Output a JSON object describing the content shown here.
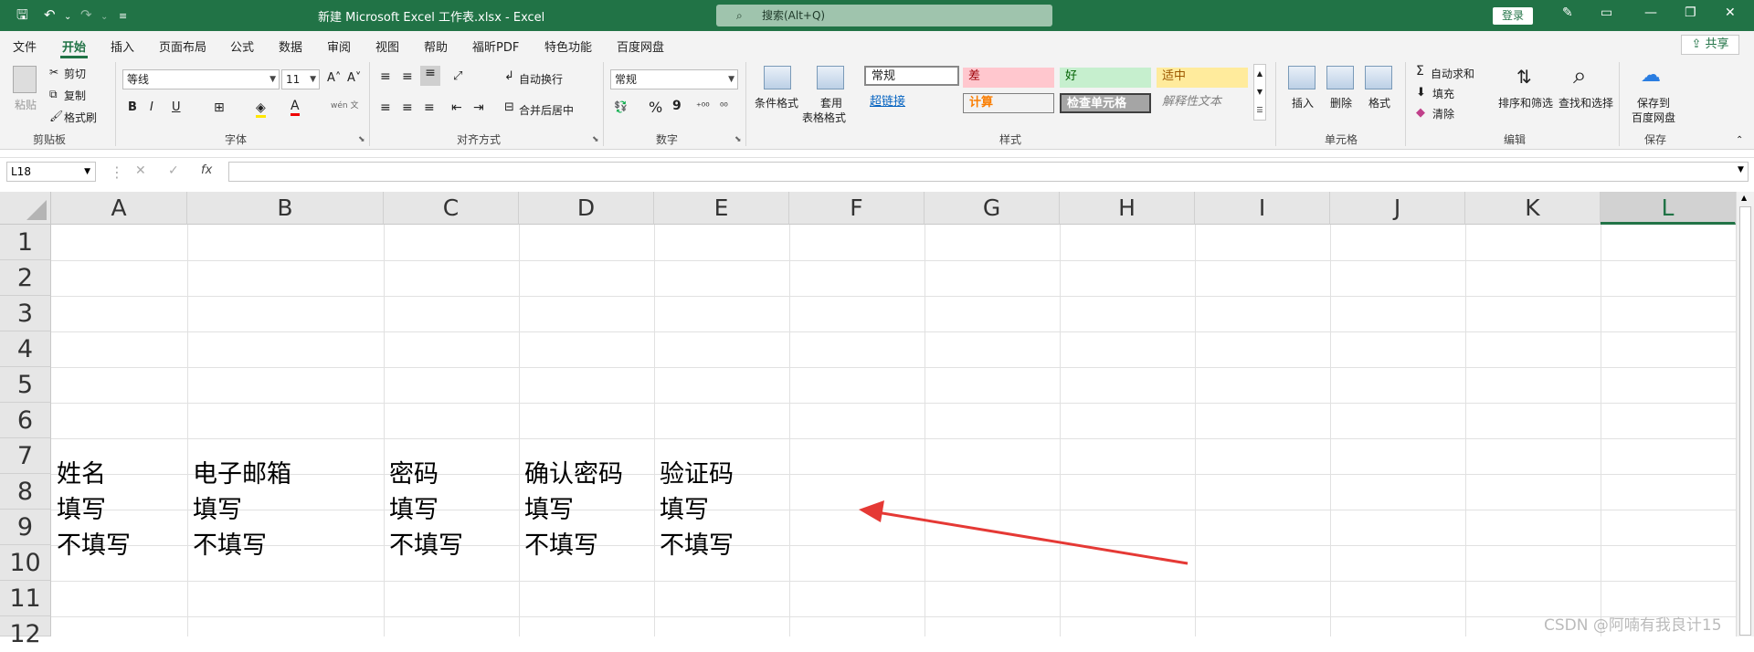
{
  "titlebar": {
    "title": "新建 Microsoft Excel 工作表.xlsx  -  Excel",
    "search_placeholder": "搜索(Alt+Q)",
    "login_label": "登录"
  },
  "menu": {
    "items": [
      "文件",
      "开始",
      "插入",
      "页面布局",
      "公式",
      "数据",
      "审阅",
      "视图",
      "帮助",
      "福昕PDF",
      "特色功能",
      "百度网盘"
    ],
    "share_label": "共享"
  },
  "ribbon": {
    "clipboard": {
      "paste": "粘贴",
      "cut": "剪切",
      "copy": "复制",
      "format_painter": "格式刷",
      "label": "剪贴板"
    },
    "font": {
      "name": "等线",
      "size": "11",
      "label": "字体",
      "bold": "B",
      "italic": "I",
      "underline": "U",
      "grow": "A˄",
      "shrink": "A˅",
      "color_a": "A",
      "wen": "wén 文"
    },
    "alignment": {
      "wrap": "自动换行",
      "merge": "合并后居中",
      "label": "对齐方式"
    },
    "number": {
      "format": "常规",
      "label": "数字",
      "percent": "%",
      "comma": "9"
    },
    "styles": {
      "conditional": "条件格式",
      "table": "套用",
      "table2": "表格格式",
      "normal": "常规",
      "bad": "差",
      "good": "好",
      "neutral": "适中",
      "hyperlink": "超链接",
      "calc": "计算",
      "check": "检查单元格",
      "explanatory": "解释性文本",
      "label": "样式"
    },
    "cells": {
      "insert": "插入",
      "delete": "删除",
      "format": "格式",
      "label": "单元格"
    },
    "editing": {
      "autosum": "自动求和",
      "fill": "填充",
      "clear": "清除",
      "sort": "排序和筛选",
      "find": "查找和选择",
      "label": "编辑"
    },
    "save": {
      "line1": "保存到",
      "line2": "百度网盘",
      "label": "保存"
    }
  },
  "formula": {
    "namebox": "L18",
    "cancel": "✕",
    "enter": "✓",
    "fx": "fx",
    "value": ""
  },
  "sheet": {
    "columns": [
      "A",
      "B",
      "C",
      "D",
      "E",
      "F",
      "G",
      "H",
      "I",
      "J",
      "K",
      "L"
    ],
    "rows": [
      "1",
      "2",
      "3",
      "4",
      "5",
      "6",
      "7",
      "8",
      "9",
      "10",
      "11",
      "12"
    ],
    "cells": {
      "r7": [
        "姓名",
        "电子邮箱",
        "密码",
        "确认密码",
        "验证码"
      ],
      "r8": [
        "填写",
        "填写",
        "填写",
        "填写",
        "填写"
      ],
      "r9": [
        "不填写",
        "不填写",
        "不填写",
        "不填写",
        "不填写"
      ]
    },
    "selected_column": "L"
  },
  "annotation": {
    "arrow_color": "#e53935"
  },
  "watermark": "CSDN @阿喃有我良计15",
  "colors": {
    "accent": "#217346"
  }
}
